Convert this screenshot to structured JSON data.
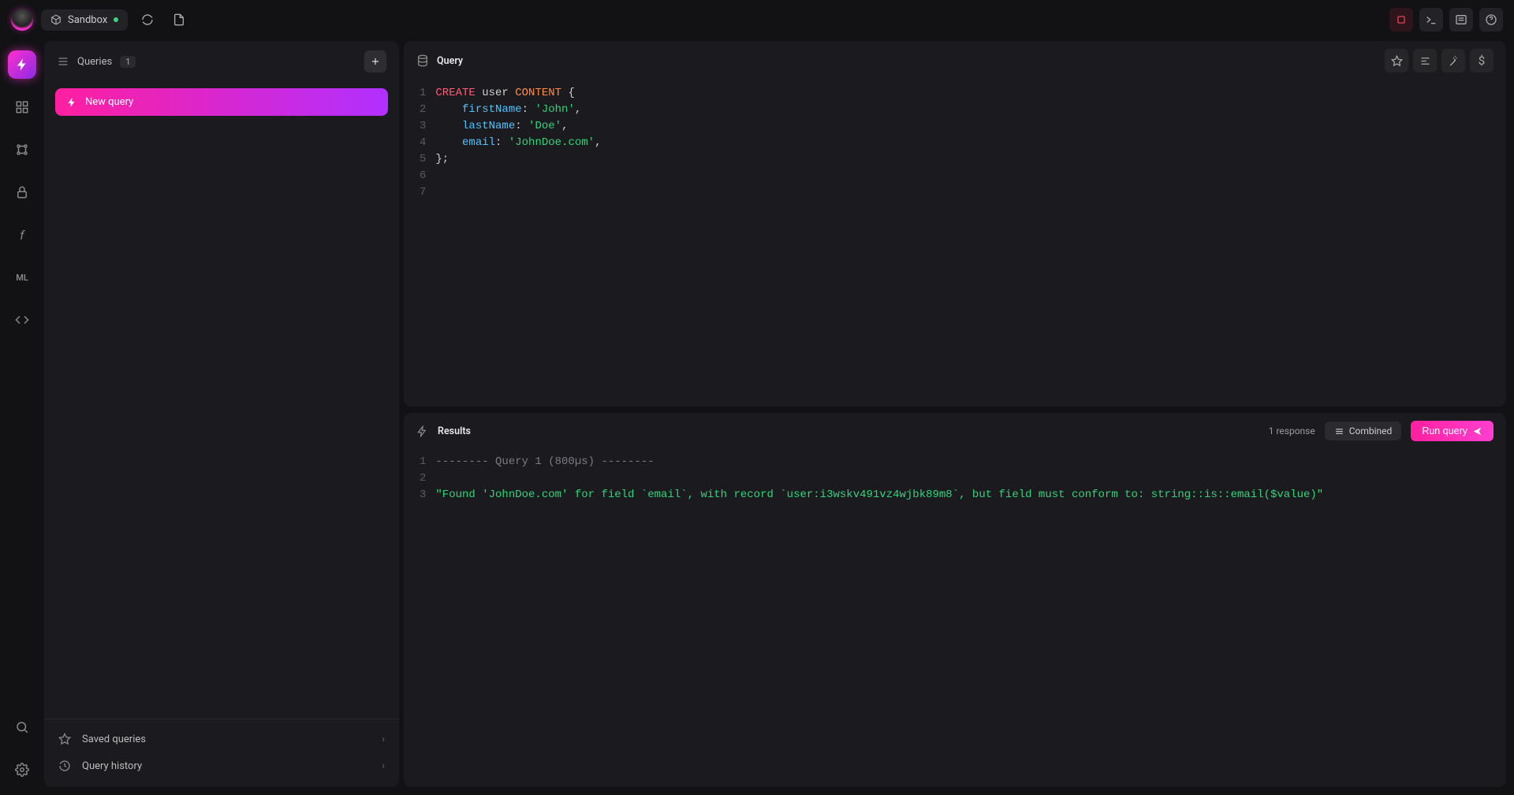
{
  "titlebar": {
    "sandbox_label": "Sandbox"
  },
  "rail": {
    "items": [
      "lightning",
      "grid",
      "graph",
      "lock",
      "function",
      "ml",
      "code"
    ]
  },
  "queries_panel": {
    "title": "Queries",
    "count": "1",
    "active_tab_label": "New query",
    "footer": {
      "saved_label": "Saved queries",
      "history_label": "Query history"
    }
  },
  "query_editor": {
    "title": "Query",
    "lines": [
      {
        "n": "1",
        "tokens": [
          {
            "t": "CREATE",
            "c": "tok-kw"
          },
          {
            "t": " user ",
            "c": "tok-punc"
          },
          {
            "t": "CONTENT",
            "c": "tok-kw2"
          },
          {
            "t": " {",
            "c": "tok-punc"
          }
        ]
      },
      {
        "n": "2",
        "tokens": [
          {
            "t": "    ",
            "c": ""
          },
          {
            "t": "firstName",
            "c": "tok-prop"
          },
          {
            "t": ": ",
            "c": "tok-punc"
          },
          {
            "t": "'John'",
            "c": "tok-str"
          },
          {
            "t": ",",
            "c": "tok-punc"
          }
        ]
      },
      {
        "n": "3",
        "tokens": [
          {
            "t": "    ",
            "c": ""
          },
          {
            "t": "lastName",
            "c": "tok-prop"
          },
          {
            "t": ": ",
            "c": "tok-punc"
          },
          {
            "t": "'Doe'",
            "c": "tok-str"
          },
          {
            "t": ",",
            "c": "tok-punc"
          }
        ]
      },
      {
        "n": "4",
        "tokens": [
          {
            "t": "    ",
            "c": ""
          },
          {
            "t": "email",
            "c": "tok-prop"
          },
          {
            "t": ": ",
            "c": "tok-punc"
          },
          {
            "t": "'JohnDoe.com'",
            "c": "tok-str"
          },
          {
            "t": ",",
            "c": "tok-punc"
          }
        ]
      },
      {
        "n": "5",
        "tokens": [
          {
            "t": "};",
            "c": "tok-punc"
          }
        ]
      },
      {
        "n": "6",
        "tokens": []
      },
      {
        "n": "7",
        "tokens": []
      }
    ]
  },
  "results": {
    "title": "Results",
    "response_count": "1 response",
    "view_mode": "Combined",
    "run_label": "Run query",
    "lines": [
      {
        "n": "1",
        "tokens": [
          {
            "t": "-------- Query 1 (800µs) --------",
            "c": "tok-comment"
          }
        ]
      },
      {
        "n": "2",
        "tokens": []
      },
      {
        "n": "3",
        "tokens": [
          {
            "t": "\"Found 'JohnDoe.com' for field `email`, with record `user:i3wskv491vz4wjbk89m8`, but field must conform to: string::is::email($value)\"",
            "c": "tok-str"
          }
        ]
      }
    ]
  }
}
